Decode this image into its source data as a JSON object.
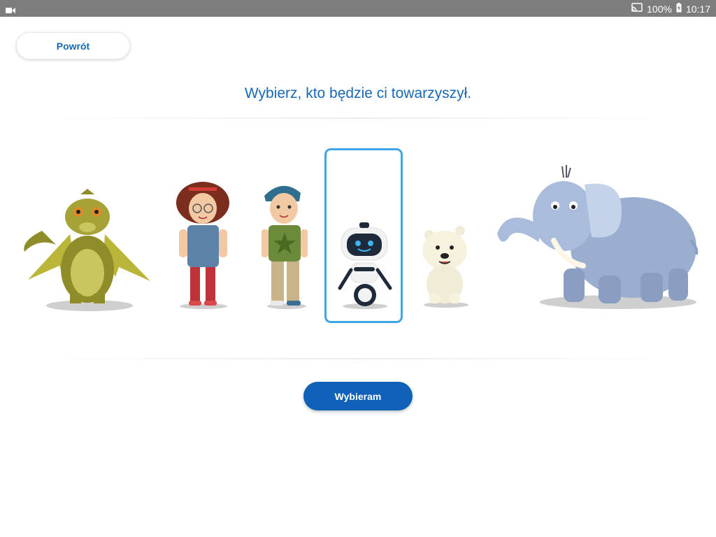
{
  "status_bar": {
    "left_icon": "camera-icon",
    "cast_icon": "cast-icon",
    "battery_text": "100%",
    "battery_icon": "battery-charging-icon",
    "time": "10:17"
  },
  "header": {
    "back_label": "Powrót",
    "title": "Wybierz, kto będzie ci towarzyszył."
  },
  "characters": [
    {
      "id": "dragon",
      "icon": "dragon-icon",
      "selected": false
    },
    {
      "id": "girl",
      "icon": "girl-icon",
      "selected": false
    },
    {
      "id": "boy",
      "icon": "boy-icon",
      "selected": false
    },
    {
      "id": "robot",
      "icon": "robot-icon",
      "selected": true
    },
    {
      "id": "polar-bear",
      "icon": "polar-bear-icon",
      "selected": false
    },
    {
      "id": "elephant",
      "icon": "elephant-icon",
      "selected": false
    }
  ],
  "actions": {
    "choose_label": "Wybieram"
  },
  "colors": {
    "accent": "#1769b8",
    "primary_button": "#0f62b8",
    "selection_border": "#3ea5e6",
    "status_bar": "#7d7d7d"
  }
}
